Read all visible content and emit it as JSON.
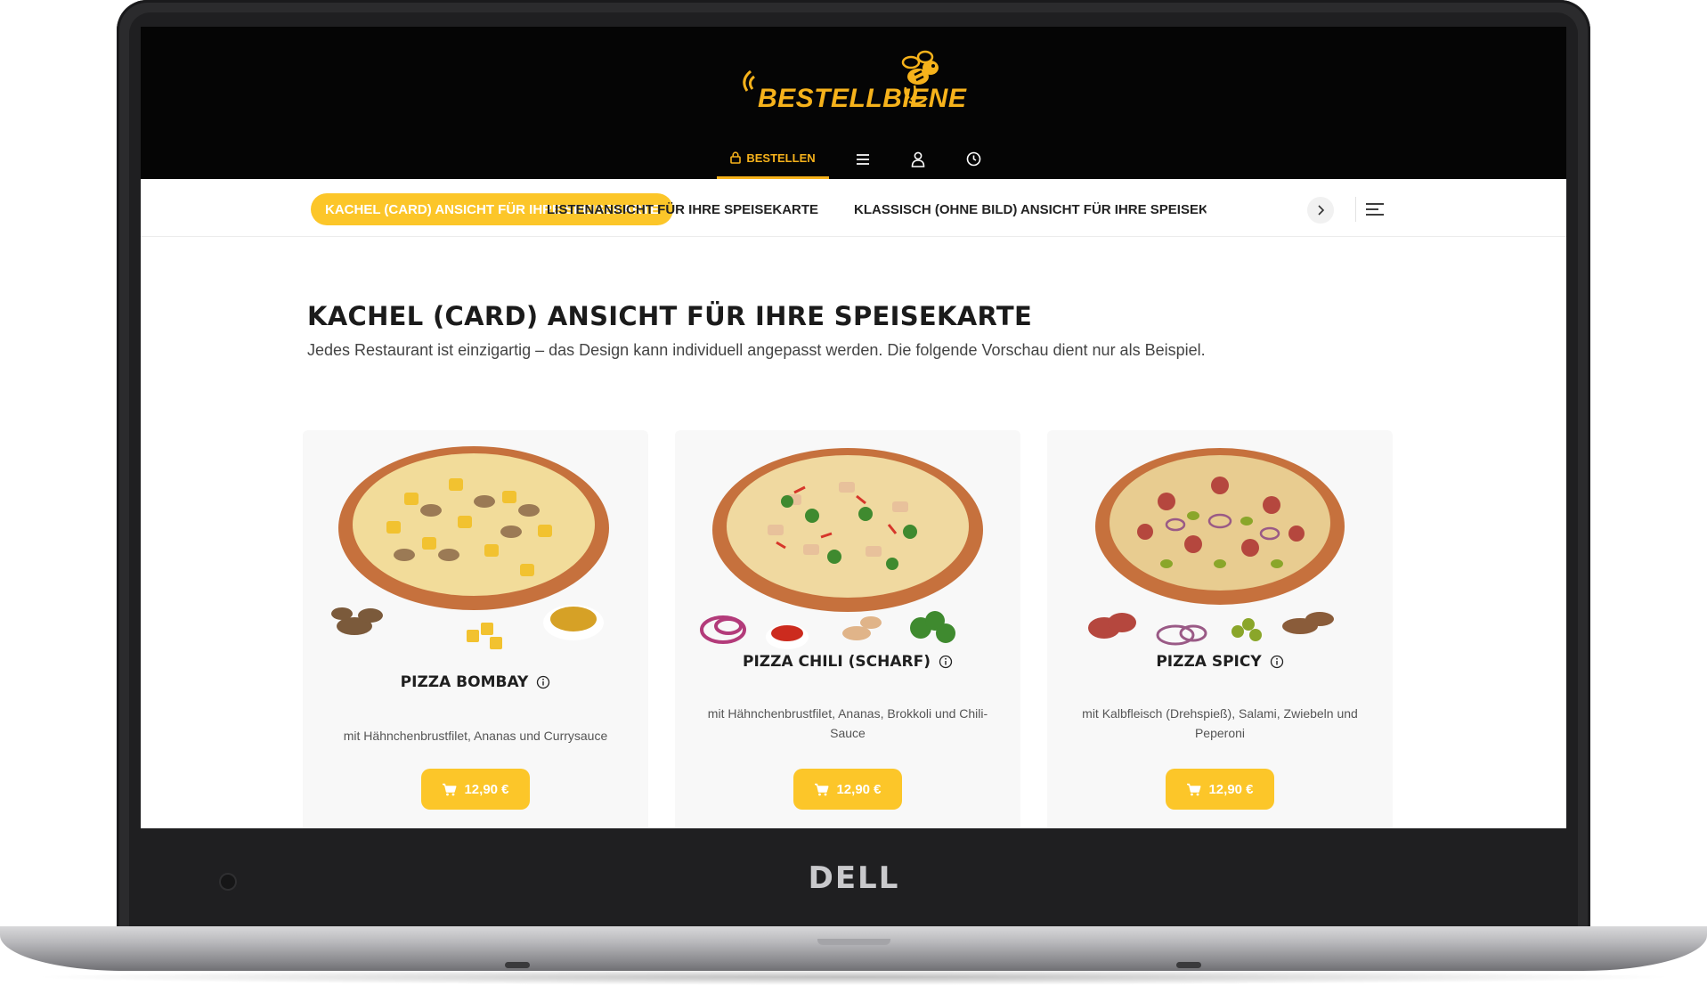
{
  "device": {
    "brand": "DELL"
  },
  "header": {
    "logo_text": "BESTELLBIENE",
    "nav": {
      "order_label": "BESTELLEN",
      "order_icon": "lock-icon",
      "menu_icon": "hamburger-icon",
      "user_icon": "user-icon",
      "clock_icon": "clock-icon"
    }
  },
  "categories": {
    "items": [
      {
        "label": "KACHEL (CARD) ANSICHT FÜR IHRE SPEISEKARTE",
        "active": true
      },
      {
        "label": "LISTENANSICHT FÜR IHRE SPEISEKARTE",
        "active": false
      },
      {
        "label": "KLASSISCH (OHNE BILD) ANSICHT FÜR IHRE SPEISEKARTE",
        "active": false
      }
    ],
    "next_icon": "chevron-right-icon",
    "list_icon": "list-icon"
  },
  "main": {
    "title": "KACHEL (CARD) ANSICHT FÜR IHRE SPEISEKARTE",
    "subtitle": "Jedes Restaurant ist einzigartig – das Design kann individuell angepasst werden. Die folgende Vorschau dient nur als Beispiel."
  },
  "products": [
    {
      "name": "PIZZA BOMBAY",
      "description": "mit Hähnchenbrustfilet, Ananas und Currysauce",
      "price": "12,90 €"
    },
    {
      "name": "PIZZA CHILI (SCHARF)",
      "description": "mit Hähnchenbrustfilet, Ananas, Brokkoli und Chili-Sauce",
      "price": "12,90 €"
    },
    {
      "name": "PIZZA SPICY",
      "description": "mit Kalbfleisch (Drehspieß), Salami, Zwiebeln und Peperoni",
      "price": "12,90 €"
    }
  ],
  "colors": {
    "accent": "#fcc629",
    "header_bg": "#050505",
    "logo": "#f6b21b"
  }
}
